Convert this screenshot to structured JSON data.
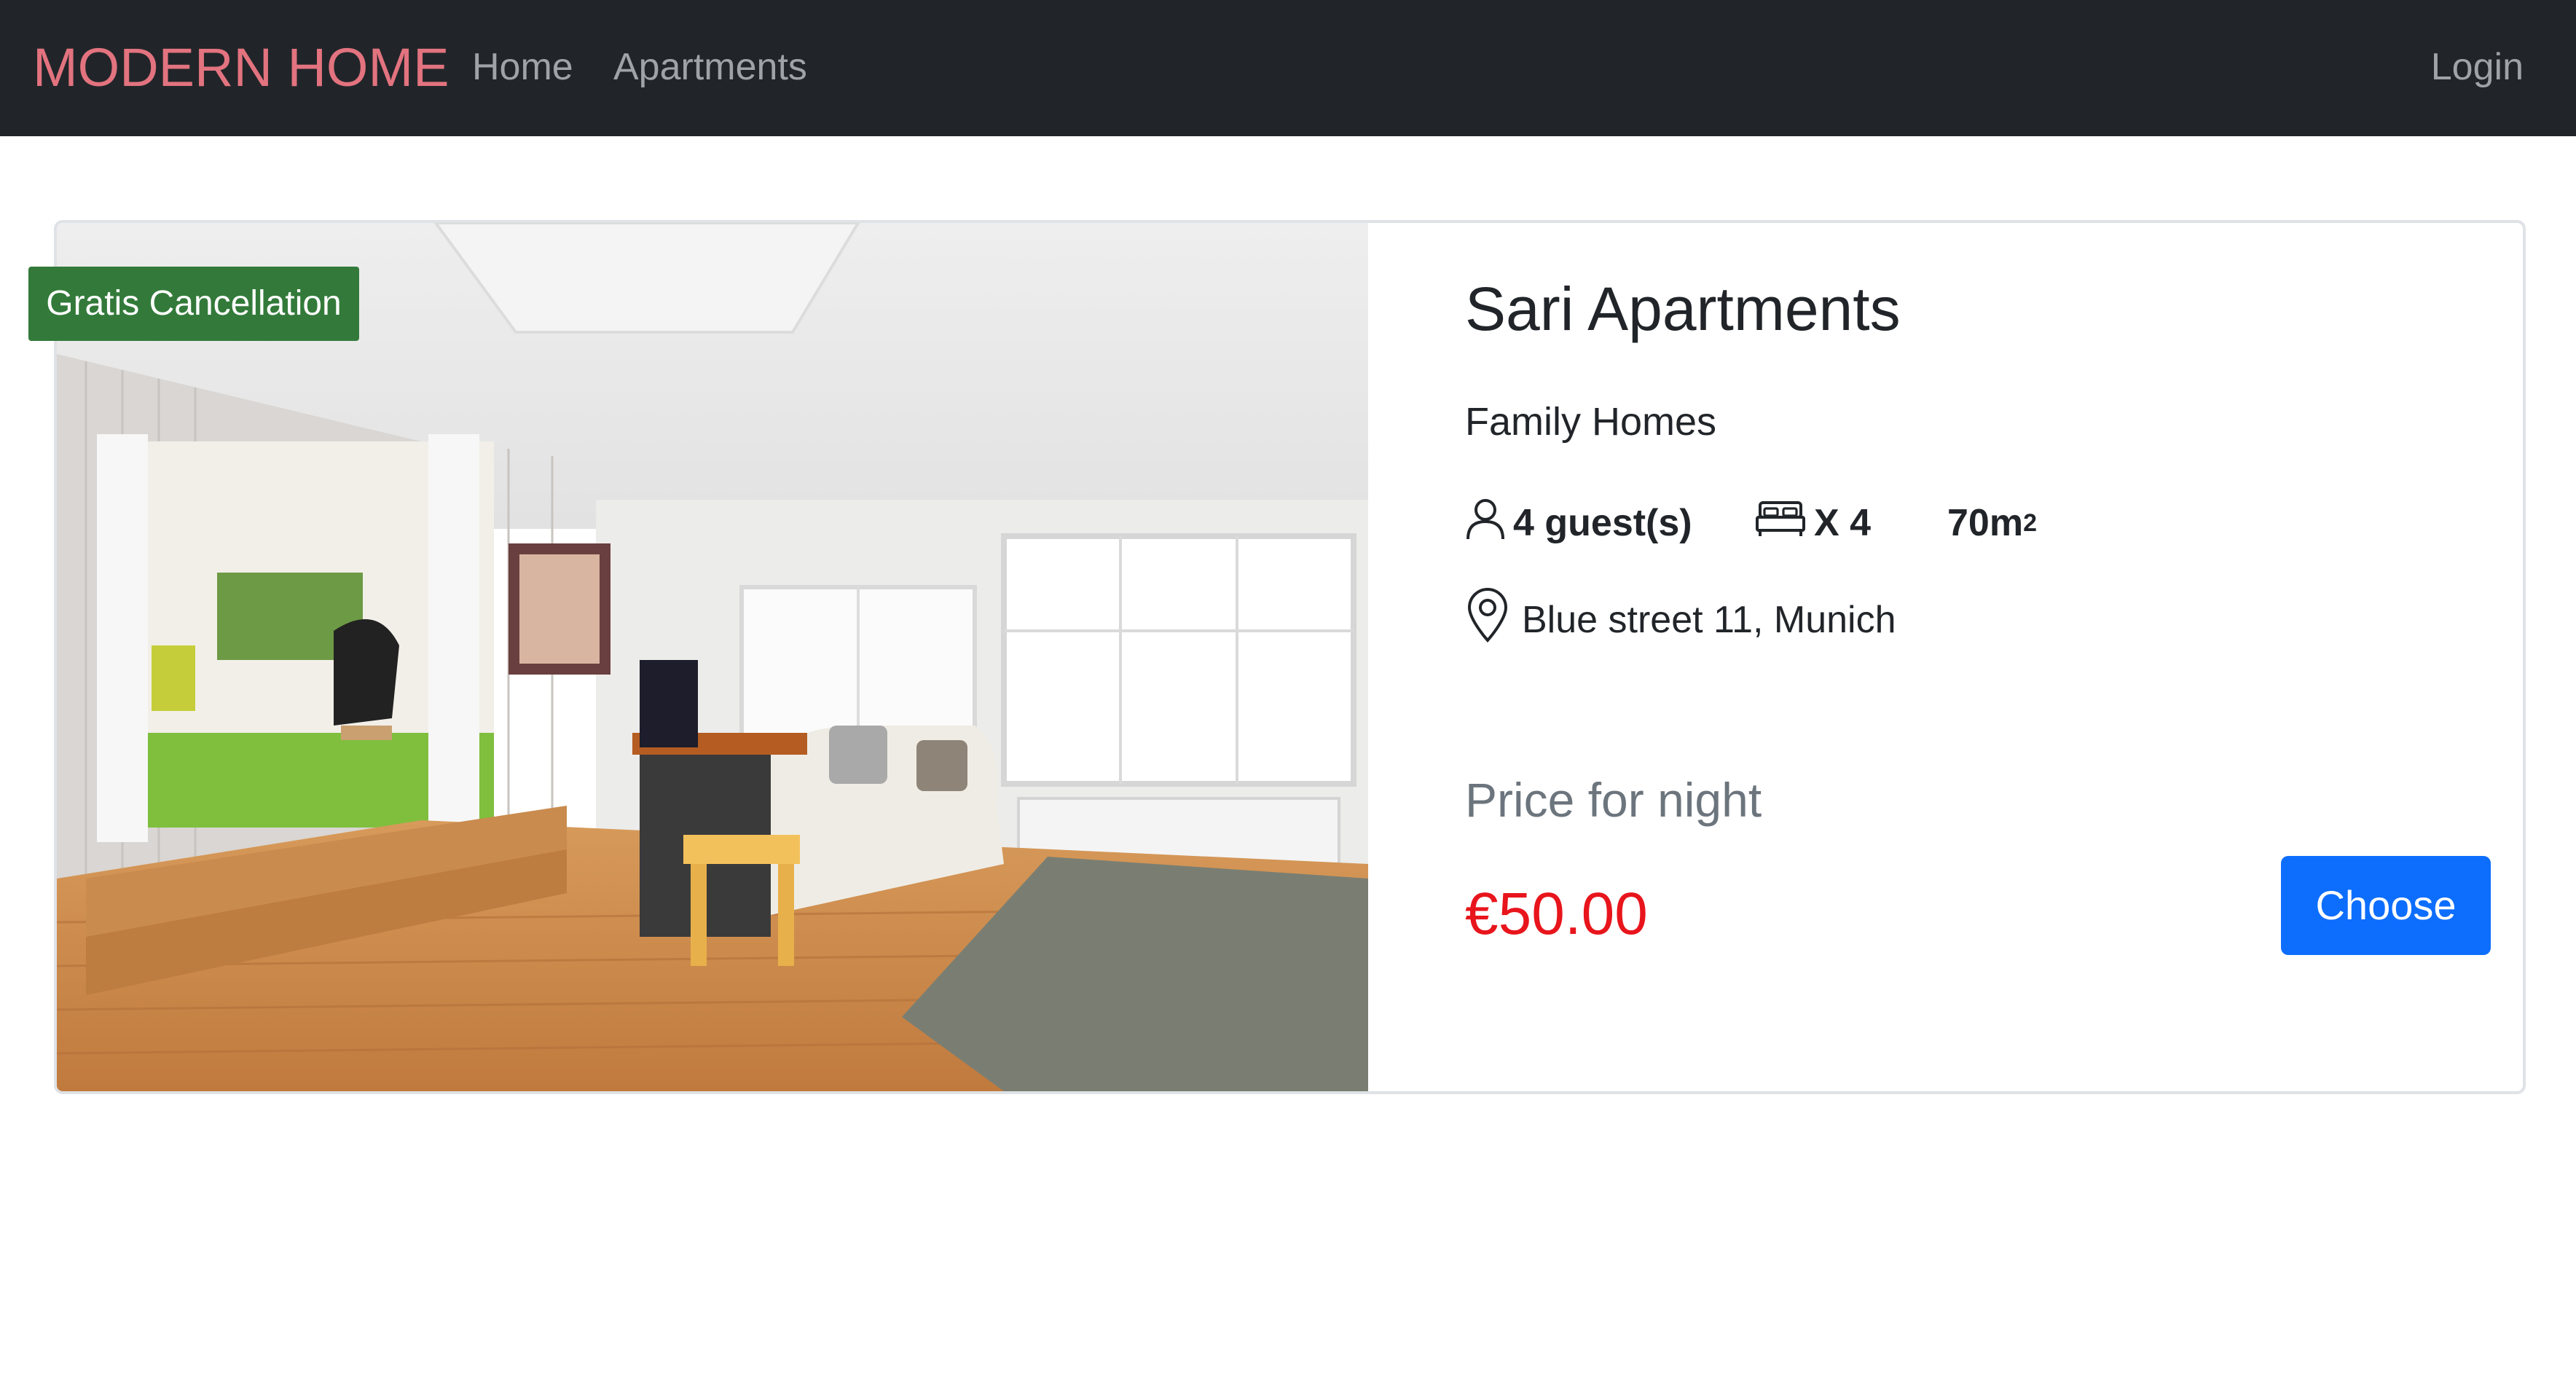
{
  "navbar": {
    "brand": "MODERN HOME",
    "links": [
      "Home",
      "Apartments"
    ],
    "login": "Login"
  },
  "listing": {
    "badge": "Gratis Cancellation",
    "image_alt": "Bright living room with wooden floor, white sofa and large windows",
    "title": "Sari Apartments",
    "category": "Family Homes",
    "guests": "4 guest(s)",
    "beds": "X 4",
    "size_value": "70m",
    "size_exponent": "2",
    "address": "Blue street 11, Munich",
    "price_label": "Price for night",
    "price": "€50.00",
    "choose_label": "Choose"
  },
  "icons": {
    "guest": "person-icon",
    "bed": "bed-icon",
    "location": "map-pin-icon"
  },
  "colors": {
    "navbar_bg": "#212529",
    "brand": "#e2737f",
    "badge_bg": "#337a3a",
    "price": "#e8151c",
    "button": "#0d6efd"
  }
}
